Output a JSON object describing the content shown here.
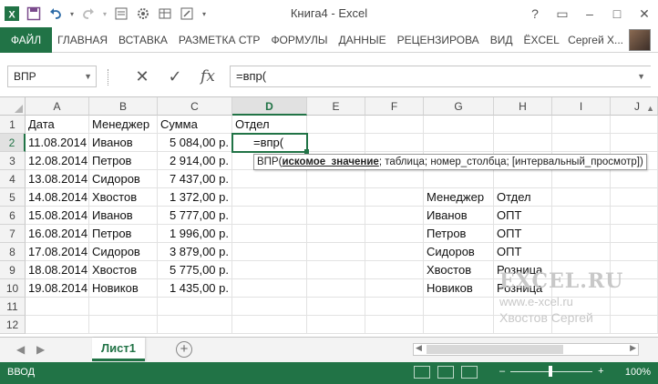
{
  "window": {
    "title": "Книга4 - Excel",
    "ctrl_help": "?",
    "ctrl_restore": "▭",
    "ctrl_minimize": "–",
    "ctrl_maximize": "□",
    "ctrl_close": "✕"
  },
  "ribbon": {
    "tabs": [
      "ФАЙЛ",
      "ГЛАВНАЯ",
      "ВСТАВКА",
      "РАЗМЕТКА СТР",
      "ФОРМУЛЫ",
      "ДАННЫЕ",
      "РЕЦЕНЗИРОВА",
      "ВИД",
      "ЁXCEL"
    ],
    "user": "Сергей Х..."
  },
  "formula_bar": {
    "name_box": "ВПР",
    "formula": "=впр(",
    "cancel_glyph": "✕",
    "enter_glyph": "✓",
    "fx_glyph": "fx"
  },
  "columns": [
    "A",
    "B",
    "C",
    "D",
    "E",
    "F",
    "G",
    "H",
    "I",
    "J"
  ],
  "rows": [
    "1",
    "2",
    "3",
    "4",
    "5",
    "6",
    "7",
    "8",
    "9",
    "10",
    "11",
    "12"
  ],
  "table1": {
    "headers": [
      "Дата",
      "Менеджер",
      "Сумма",
      "Отдел"
    ],
    "rows": [
      [
        "11.08.2014",
        "Иванов",
        "5 084,00 р."
      ],
      [
        "12.08.2014",
        "Петров",
        "2 914,00 р."
      ],
      [
        "13.08.2014",
        "Сидоров",
        "7 437,00 р."
      ],
      [
        "14.08.2014",
        "Хвостов",
        "1 372,00 р."
      ],
      [
        "15.08.2014",
        "Иванов",
        "5 777,00 р."
      ],
      [
        "16.08.2014",
        "Петров",
        "1 996,00 р."
      ],
      [
        "17.08.2014",
        "Сидоров",
        "3 879,00 р."
      ],
      [
        "18.08.2014",
        "Хвостов",
        "5 775,00 р."
      ],
      [
        "19.08.2014",
        "Новиков",
        "1 435,00 р."
      ]
    ],
    "editing_cell": "=впр("
  },
  "table2": {
    "headers": [
      "Менеджер",
      "Отдел"
    ],
    "rows": [
      [
        "Иванов",
        "ОПТ"
      ],
      [
        "Петров",
        "ОПТ"
      ],
      [
        "Сидоров",
        "ОПТ"
      ],
      [
        "Хвостов",
        "Розница"
      ],
      [
        "Новиков",
        "Розница"
      ]
    ]
  },
  "tooltip": {
    "fn": "ВПР(",
    "arg1": "искомое_значение",
    "rest": "; таблица; номер_столбца; [интервальный_просмотр])"
  },
  "watermark": {
    "logo": "EXCEL.RU",
    "site": "www.e-xcel.ru",
    "author": "Хвостов Сергей"
  },
  "sheets": {
    "active": "Лист1",
    "add_glyph": "+"
  },
  "status": {
    "mode": "ВВОД",
    "zoom_minus": "–",
    "zoom_plus": "+",
    "zoom": "100%",
    "zoom_level_percent": 100
  },
  "colors": {
    "accent": "#217346",
    "grid": "#e2e2e2",
    "header_bg": "#f3f3f3"
  }
}
